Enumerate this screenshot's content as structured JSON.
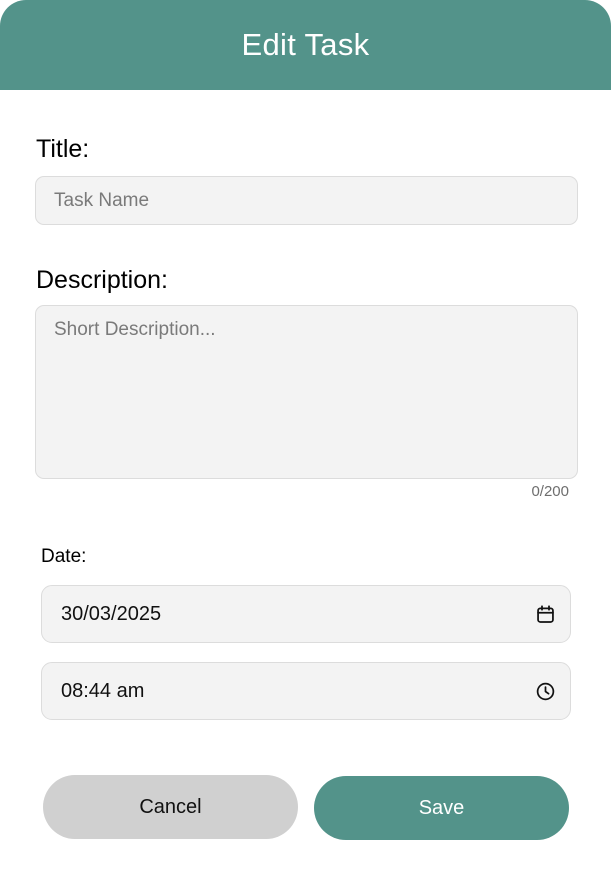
{
  "colors": {
    "accent": "#53938a",
    "field_background": "#f3f3f3",
    "cancel_background": "#d0d0d0"
  },
  "header": {
    "title": "Edit Task"
  },
  "form": {
    "title_label": "Title:",
    "title_value": "",
    "title_placeholder": "Task Name",
    "description_label": "Description:",
    "description_value": "",
    "description_placeholder": "Short Description...",
    "description_counter": "0/200",
    "date_label": "Date:",
    "date_value": "30/03/2025",
    "date_icon": "calendar-icon",
    "time_value": "08:44 am",
    "time_icon": "clock-icon"
  },
  "actions": {
    "cancel_label": "Cancel",
    "save_label": "Save"
  }
}
